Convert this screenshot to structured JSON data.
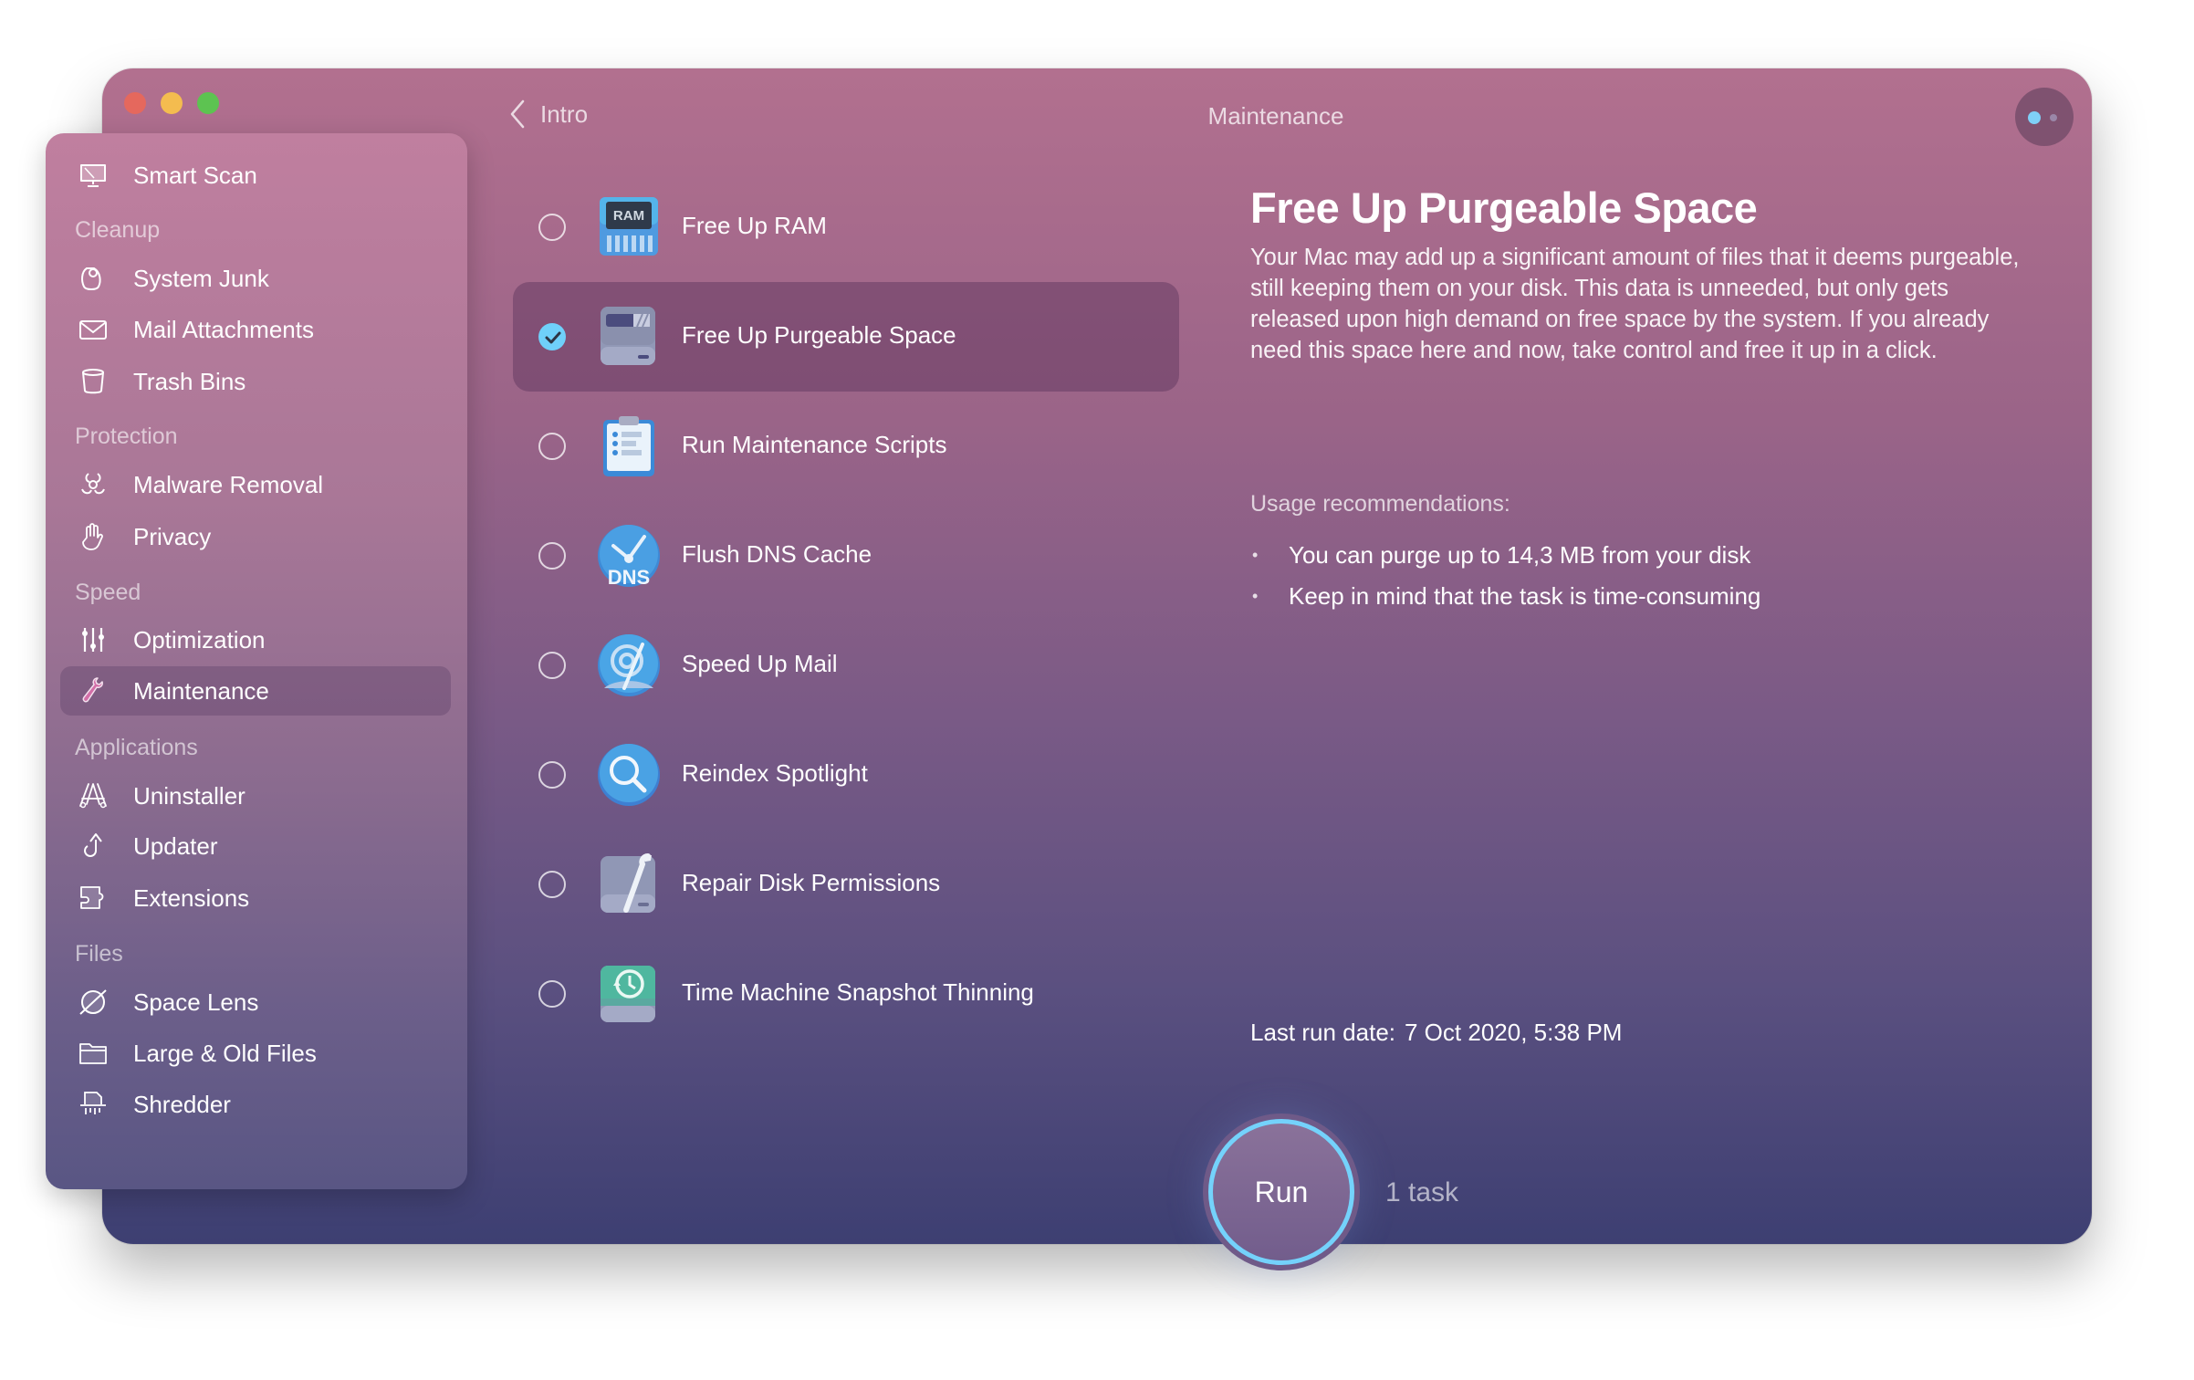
{
  "window": {
    "title": "Maintenance",
    "back_label": "Intro",
    "traffic_lights": [
      "close",
      "minimize",
      "zoom"
    ],
    "assistant_button": "assistant-icon"
  },
  "colors": {
    "accent": "#6fd0fa",
    "gradient_top": "#b2708f",
    "gradient_bottom": "#3d3f72",
    "close": "#e5685d",
    "minimize": "#f4bc4f",
    "zoom": "#5dc351"
  },
  "sidebar": {
    "top_item": {
      "label": "Smart Scan",
      "icon": "monitor-icon"
    },
    "sections": [
      {
        "title": "Cleanup",
        "items": [
          {
            "label": "System Junk",
            "icon": "system-junk-icon"
          },
          {
            "label": "Mail Attachments",
            "icon": "envelope-icon"
          },
          {
            "label": "Trash Bins",
            "icon": "trash-icon"
          }
        ]
      },
      {
        "title": "Protection",
        "items": [
          {
            "label": "Malware Removal",
            "icon": "biohazard-icon"
          },
          {
            "label": "Privacy",
            "icon": "hand-icon"
          }
        ]
      },
      {
        "title": "Speed",
        "items": [
          {
            "label": "Optimization",
            "icon": "sliders-icon"
          },
          {
            "label": "Maintenance",
            "icon": "wrench-icon",
            "active": true
          }
        ]
      },
      {
        "title": "Applications",
        "items": [
          {
            "label": "Uninstaller",
            "icon": "app-store-icon"
          },
          {
            "label": "Updater",
            "icon": "update-arrow-icon"
          },
          {
            "label": "Extensions",
            "icon": "puzzle-icon"
          }
        ]
      },
      {
        "title": "Files",
        "items": [
          {
            "label": "Space Lens",
            "icon": "planet-icon"
          },
          {
            "label": "Large & Old Files",
            "icon": "folder-icon"
          },
          {
            "label": "Shredder",
            "icon": "shredder-icon"
          }
        ]
      }
    ]
  },
  "tasks": [
    {
      "label": "Free Up RAM",
      "icon": "ram-icon",
      "checked": false
    },
    {
      "label": "Free Up Purgeable Space",
      "icon": "disk-icon",
      "checked": true,
      "selected": true
    },
    {
      "label": "Run Maintenance Scripts",
      "icon": "clipboard-icon",
      "checked": false
    },
    {
      "label": "Flush DNS Cache",
      "icon": "dns-icon",
      "checked": false
    },
    {
      "label": "Speed Up Mail",
      "icon": "mail-speed-icon",
      "checked": false
    },
    {
      "label": "Reindex Spotlight",
      "icon": "spotlight-icon",
      "checked": false
    },
    {
      "label": "Repair Disk Permissions",
      "icon": "disk-wrench-icon",
      "checked": false
    },
    {
      "label": "Time Machine Snapshot Thinning",
      "icon": "time-machine-icon",
      "checked": false
    }
  ],
  "detail": {
    "title": "Free Up Purgeable Space",
    "description": "Your Mac may add up a significant amount of files that it deems purgeable, still keeping them on your disk. This data is unneeded, but only gets released upon high demand on free space by the system. If you already need this space here and now, take control and free it up in a click.",
    "usage_heading": "Usage recommendations:",
    "usage_items": [
      "You can purge up to 14,3 MB from your disk",
      "Keep in mind that the task is time-consuming"
    ],
    "bullet": "•",
    "last_run_label": "Last run date:",
    "last_run_value": "7 Oct 2020, 5:38 PM"
  },
  "footer": {
    "run_label": "Run",
    "task_count": "1 task"
  }
}
